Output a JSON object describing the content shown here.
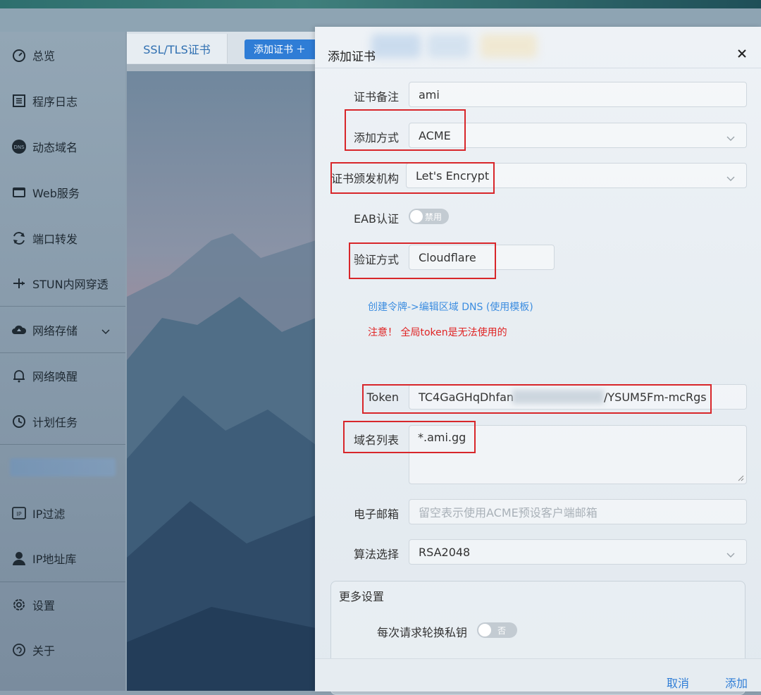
{
  "sidebar": {
    "items": [
      {
        "label": "总览",
        "icon": "dashboard-icon"
      },
      {
        "label": "程序日志",
        "icon": "log-icon"
      },
      {
        "label": "动态域名",
        "icon": "dns-icon"
      },
      {
        "label": "Web服务",
        "icon": "web-service-icon"
      },
      {
        "label": "端口转发",
        "icon": "port-forward-icon"
      },
      {
        "label": "STUN内网穿透",
        "icon": "stun-icon"
      },
      {
        "label": "网络存储",
        "icon": "cloud-storage-icon"
      },
      {
        "label": "网络唤醒",
        "icon": "bell-icon"
      },
      {
        "label": "计划任务",
        "icon": "clock-icon"
      },
      {
        "label": "IP过滤",
        "icon": "ip-filter-icon"
      },
      {
        "label": "IP地址库",
        "icon": "user-icon"
      },
      {
        "label": "设置",
        "icon": "gear-icon"
      },
      {
        "label": "关于",
        "icon": "about-icon"
      }
    ]
  },
  "main": {
    "tab_label": "SSL/TLS证书",
    "add_button": "添加证书 ＋"
  },
  "modal": {
    "title": "添加证书",
    "fields": {
      "remark": {
        "label": "证书备注",
        "value": "ami"
      },
      "method": {
        "label": "添加方式",
        "value": "ACME"
      },
      "ca": {
        "label": "证书颁发机构",
        "value": "Let's Encrypt"
      },
      "eab": {
        "label": "EAB认证",
        "toggle": "禁用"
      },
      "verify": {
        "label": "验证方式",
        "value": "Cloudflare"
      },
      "token": {
        "label": "Token",
        "value_start": "TC4GaGHqDhfan",
        "value_end": "/YSUM5Fm-mcRgs"
      },
      "domains": {
        "label": "域名列表",
        "value": "*.ami.gg"
      },
      "email": {
        "label": "电子邮箱",
        "placeholder": "留空表示使用ACME预设客户端邮箱"
      },
      "algo": {
        "label": "算法选择",
        "value": "RSA2048"
      }
    },
    "link_text": "创建令牌->编辑区域 DNS (使用模板)",
    "warning": "注意！ 全局token是无法使用的",
    "more_settings": {
      "title": "更多设置",
      "rotate_label": "每次请求轮换私钥",
      "rotate_toggle": "否"
    },
    "footer": {
      "cancel": "取消",
      "add": "添加"
    }
  },
  "colors": {
    "accent": "#2f7dd6",
    "warning": "#e02424",
    "highlight_box": "#d8262a",
    "link": "#3c8de0"
  }
}
